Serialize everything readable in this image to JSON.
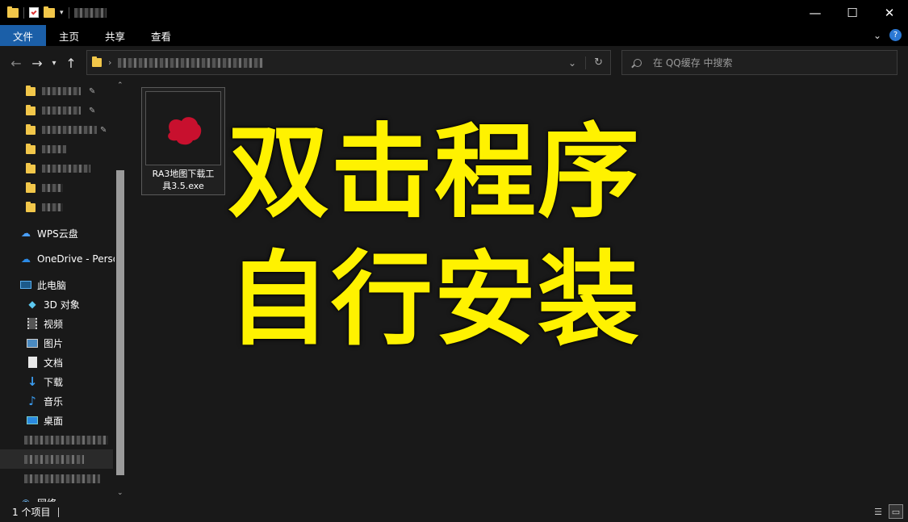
{
  "ribbon": {
    "tabs": [
      "文件",
      "主页",
      "共享",
      "查看"
    ]
  },
  "window": {
    "minimize_glyph": "—",
    "maximize_glyph": "☐",
    "close_glyph": "✕"
  },
  "search": {
    "placeholder": "在 QQ缓存 中搜索"
  },
  "sidebar": {
    "wps": "WPS云盘",
    "onedrive": "OneDrive - Perso",
    "this_pc": "此电脑",
    "items": [
      "3D 对象",
      "视频",
      "图片",
      "文档",
      "下载",
      "音乐",
      "桌面"
    ],
    "network": "网络"
  },
  "file": {
    "name_line1": "RA3地图下载工",
    "name_line2": "具3.5.exe"
  },
  "overlay": {
    "line1": "双击程序",
    "line2": "自行安装"
  },
  "status": {
    "count": "1 个项目"
  },
  "colors": {
    "file_tab": "#1b5fa8",
    "overlay_text": "#fff200",
    "background": "#191919"
  }
}
